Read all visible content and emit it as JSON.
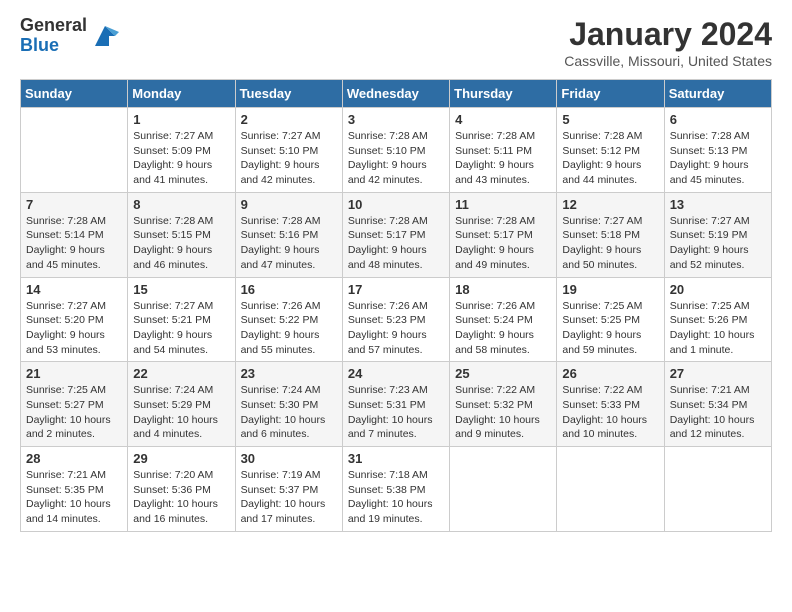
{
  "logo": {
    "general": "General",
    "blue": "Blue"
  },
  "title": "January 2024",
  "location": "Cassville, Missouri, United States",
  "days_header": [
    "Sunday",
    "Monday",
    "Tuesday",
    "Wednesday",
    "Thursday",
    "Friday",
    "Saturday"
  ],
  "weeks": [
    [
      {
        "day": "",
        "info": ""
      },
      {
        "day": "1",
        "info": "Sunrise: 7:27 AM\nSunset: 5:09 PM\nDaylight: 9 hours\nand 41 minutes."
      },
      {
        "day": "2",
        "info": "Sunrise: 7:27 AM\nSunset: 5:10 PM\nDaylight: 9 hours\nand 42 minutes."
      },
      {
        "day": "3",
        "info": "Sunrise: 7:28 AM\nSunset: 5:10 PM\nDaylight: 9 hours\nand 42 minutes."
      },
      {
        "day": "4",
        "info": "Sunrise: 7:28 AM\nSunset: 5:11 PM\nDaylight: 9 hours\nand 43 minutes."
      },
      {
        "day": "5",
        "info": "Sunrise: 7:28 AM\nSunset: 5:12 PM\nDaylight: 9 hours\nand 44 minutes."
      },
      {
        "day": "6",
        "info": "Sunrise: 7:28 AM\nSunset: 5:13 PM\nDaylight: 9 hours\nand 45 minutes."
      }
    ],
    [
      {
        "day": "7",
        "info": "Sunrise: 7:28 AM\nSunset: 5:14 PM\nDaylight: 9 hours\nand 45 minutes."
      },
      {
        "day": "8",
        "info": "Sunrise: 7:28 AM\nSunset: 5:15 PM\nDaylight: 9 hours\nand 46 minutes."
      },
      {
        "day": "9",
        "info": "Sunrise: 7:28 AM\nSunset: 5:16 PM\nDaylight: 9 hours\nand 47 minutes."
      },
      {
        "day": "10",
        "info": "Sunrise: 7:28 AM\nSunset: 5:17 PM\nDaylight: 9 hours\nand 48 minutes."
      },
      {
        "day": "11",
        "info": "Sunrise: 7:28 AM\nSunset: 5:17 PM\nDaylight: 9 hours\nand 49 minutes."
      },
      {
        "day": "12",
        "info": "Sunrise: 7:27 AM\nSunset: 5:18 PM\nDaylight: 9 hours\nand 50 minutes."
      },
      {
        "day": "13",
        "info": "Sunrise: 7:27 AM\nSunset: 5:19 PM\nDaylight: 9 hours\nand 52 minutes."
      }
    ],
    [
      {
        "day": "14",
        "info": "Sunrise: 7:27 AM\nSunset: 5:20 PM\nDaylight: 9 hours\nand 53 minutes."
      },
      {
        "day": "15",
        "info": "Sunrise: 7:27 AM\nSunset: 5:21 PM\nDaylight: 9 hours\nand 54 minutes."
      },
      {
        "day": "16",
        "info": "Sunrise: 7:26 AM\nSunset: 5:22 PM\nDaylight: 9 hours\nand 55 minutes."
      },
      {
        "day": "17",
        "info": "Sunrise: 7:26 AM\nSunset: 5:23 PM\nDaylight: 9 hours\nand 57 minutes."
      },
      {
        "day": "18",
        "info": "Sunrise: 7:26 AM\nSunset: 5:24 PM\nDaylight: 9 hours\nand 58 minutes."
      },
      {
        "day": "19",
        "info": "Sunrise: 7:25 AM\nSunset: 5:25 PM\nDaylight: 9 hours\nand 59 minutes."
      },
      {
        "day": "20",
        "info": "Sunrise: 7:25 AM\nSunset: 5:26 PM\nDaylight: 10 hours\nand 1 minute."
      }
    ],
    [
      {
        "day": "21",
        "info": "Sunrise: 7:25 AM\nSunset: 5:27 PM\nDaylight: 10 hours\nand 2 minutes."
      },
      {
        "day": "22",
        "info": "Sunrise: 7:24 AM\nSunset: 5:29 PM\nDaylight: 10 hours\nand 4 minutes."
      },
      {
        "day": "23",
        "info": "Sunrise: 7:24 AM\nSunset: 5:30 PM\nDaylight: 10 hours\nand 6 minutes."
      },
      {
        "day": "24",
        "info": "Sunrise: 7:23 AM\nSunset: 5:31 PM\nDaylight: 10 hours\nand 7 minutes."
      },
      {
        "day": "25",
        "info": "Sunrise: 7:22 AM\nSunset: 5:32 PM\nDaylight: 10 hours\nand 9 minutes."
      },
      {
        "day": "26",
        "info": "Sunrise: 7:22 AM\nSunset: 5:33 PM\nDaylight: 10 hours\nand 10 minutes."
      },
      {
        "day": "27",
        "info": "Sunrise: 7:21 AM\nSunset: 5:34 PM\nDaylight: 10 hours\nand 12 minutes."
      }
    ],
    [
      {
        "day": "28",
        "info": "Sunrise: 7:21 AM\nSunset: 5:35 PM\nDaylight: 10 hours\nand 14 minutes."
      },
      {
        "day": "29",
        "info": "Sunrise: 7:20 AM\nSunset: 5:36 PM\nDaylight: 10 hours\nand 16 minutes."
      },
      {
        "day": "30",
        "info": "Sunrise: 7:19 AM\nSunset: 5:37 PM\nDaylight: 10 hours\nand 17 minutes."
      },
      {
        "day": "31",
        "info": "Sunrise: 7:18 AM\nSunset: 5:38 PM\nDaylight: 10 hours\nand 19 minutes."
      },
      {
        "day": "",
        "info": ""
      },
      {
        "day": "",
        "info": ""
      },
      {
        "day": "",
        "info": ""
      }
    ]
  ]
}
